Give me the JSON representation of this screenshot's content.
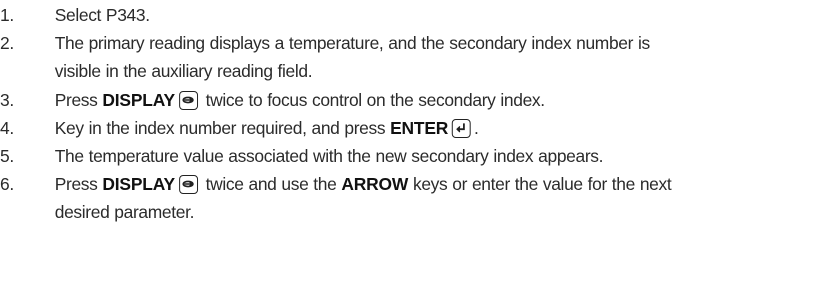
{
  "steps": [
    {
      "num": "1.",
      "text": "Select P343."
    },
    {
      "num": "2.",
      "line1": "The primary reading displays a temperature, and the secondary index number is",
      "line2": "visible in the auxiliary reading field."
    },
    {
      "num": "3.",
      "pre": "Press",
      "keyword": "DISPLAY",
      "post": "twice to focus control on the secondary index.",
      "icon": "display-key-icon"
    },
    {
      "num": "4.",
      "pre": "Key in the index number required, and press",
      "keyword": "ENTER",
      "post": ".",
      "icon": "enter-key-icon"
    },
    {
      "num": "5.",
      "text": "The temperature value associated with the new secondary index appears."
    },
    {
      "num": "6.",
      "pre": "Press",
      "keyword": "DISPLAY",
      "mid": "twice and use the",
      "keyword2": "ARROW",
      "post": "keys or enter the value for the next",
      "line2": "desired parameter.",
      "icon": "display-key-icon"
    }
  ]
}
